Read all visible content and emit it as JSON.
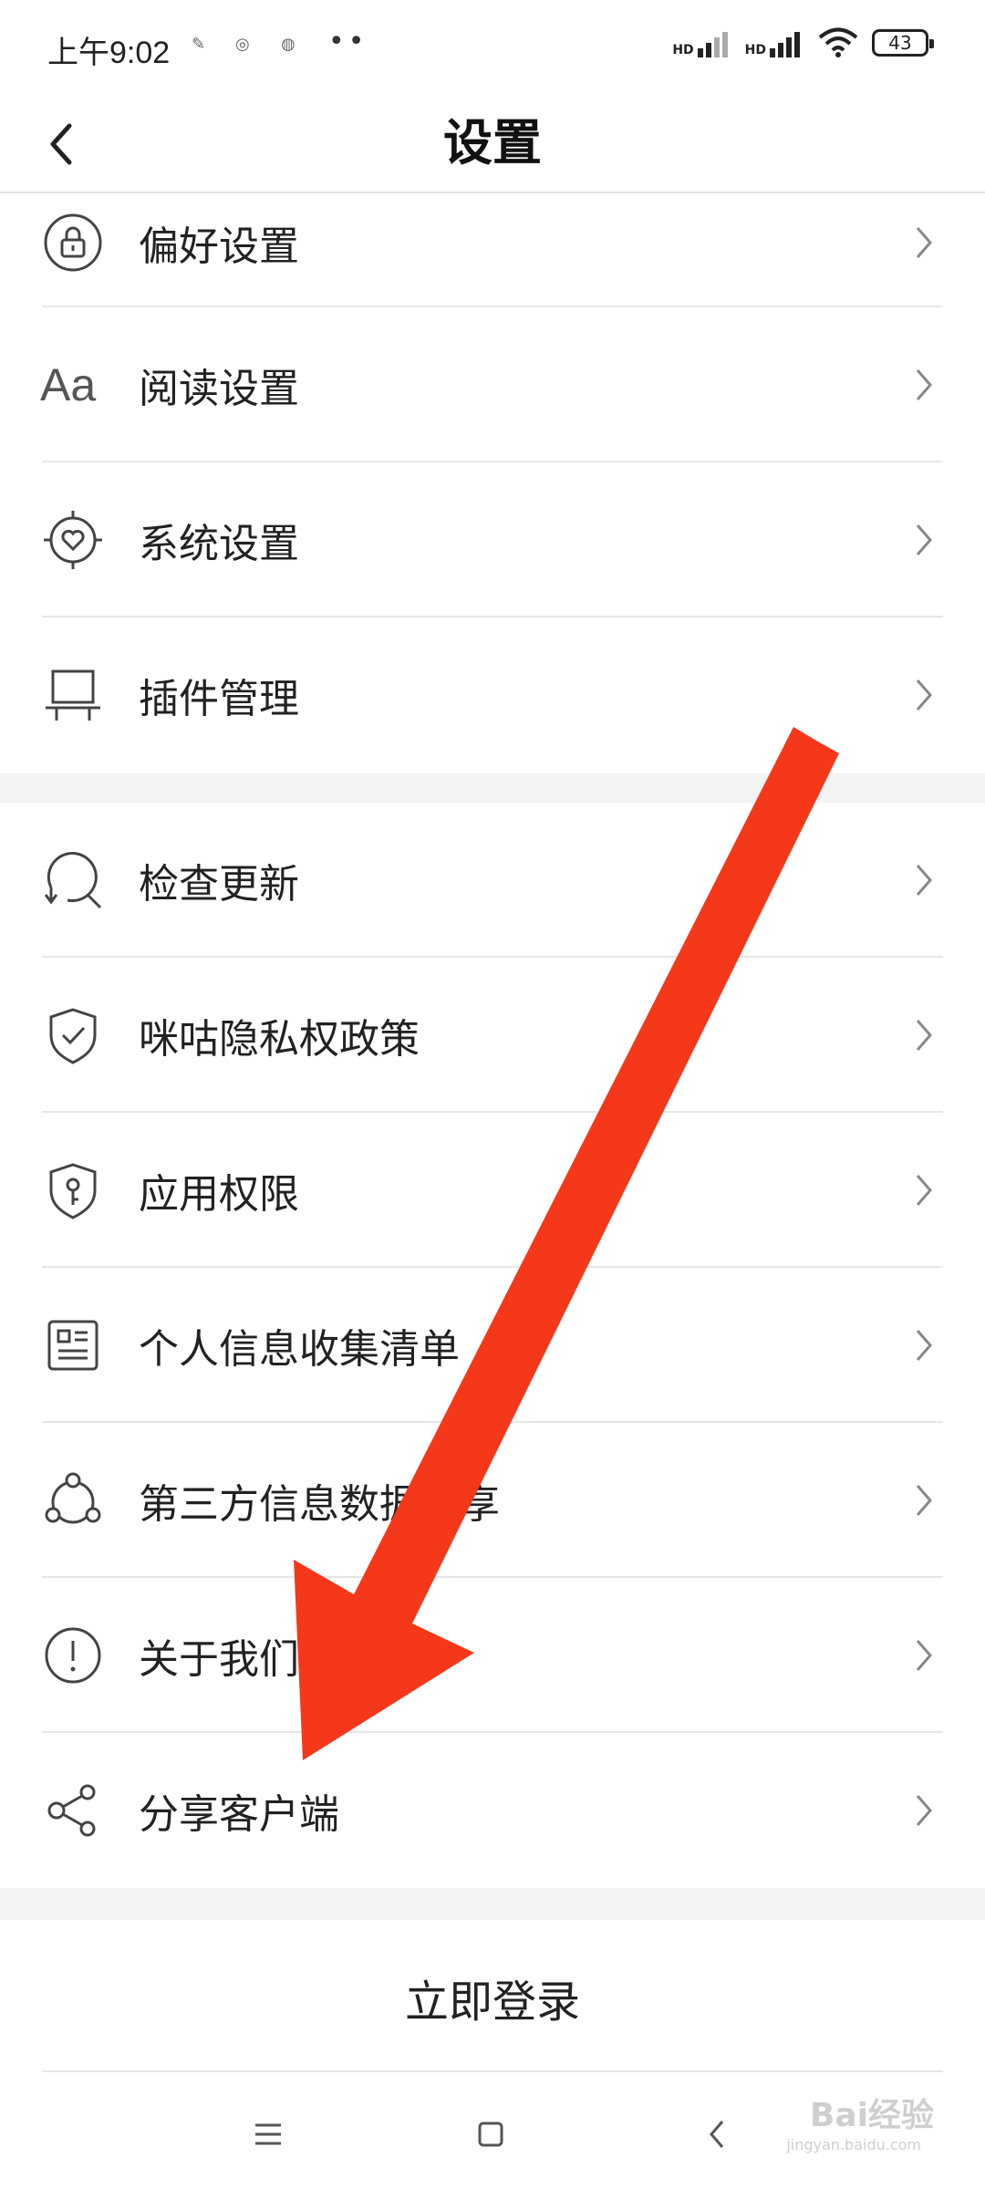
{
  "status_bar": {
    "time": "上午9:02",
    "signal1_label": "HD",
    "signal2_label": "HD",
    "battery": "43"
  },
  "header": {
    "title": "设置"
  },
  "group1": [
    {
      "label": "偏好设置",
      "icon": "lock-circle-icon"
    },
    {
      "label": "阅读设置",
      "icon": "text-aa-icon"
    },
    {
      "label": "系统设置",
      "icon": "gear-heart-icon"
    },
    {
      "label": "插件管理",
      "icon": "plugin-frame-icon"
    }
  ],
  "group2": [
    {
      "label": "检查更新",
      "icon": "search-refresh-icon"
    },
    {
      "label": "咪咕隐私权政策",
      "icon": "shield-check-icon"
    },
    {
      "label": "应用权限",
      "icon": "shield-key-icon"
    },
    {
      "label": "个人信息收集清单",
      "icon": "document-list-icon"
    },
    {
      "label": "第三方信息数据共享",
      "icon": "share-circle-icon"
    },
    {
      "label": "关于我们",
      "icon": "info-exclamation-icon"
    },
    {
      "label": "分享客户端",
      "icon": "share-nodes-icon"
    }
  ],
  "login": {
    "label": "立即登录"
  },
  "watermark": {
    "brand": "Bai经验",
    "url": "jingyan.baidu.com"
  },
  "colors": {
    "annotation_arrow": "#f5381a",
    "divider": "#e6e6e6",
    "section_gap": "#f3f3f3"
  }
}
